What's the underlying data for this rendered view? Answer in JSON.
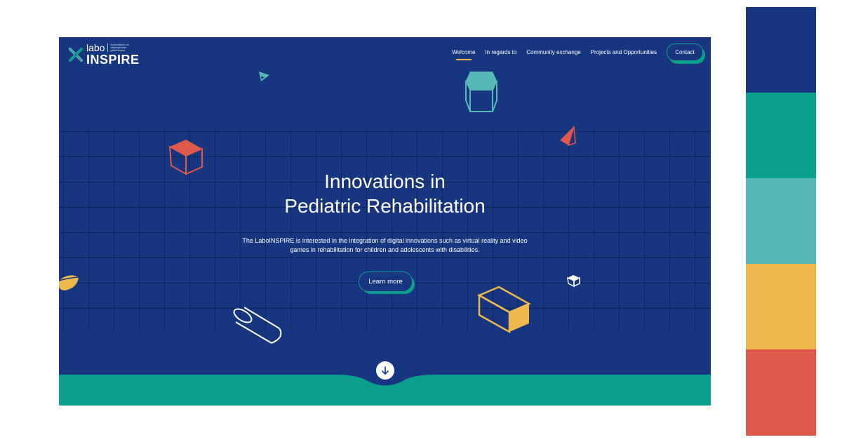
{
  "brand": {
    "labo": "labo",
    "tagline": "Innovations en réadaptation pédiatrique",
    "name": "INSPIRE"
  },
  "nav": {
    "items": [
      {
        "label": "Welcome",
        "active": true
      },
      {
        "label": "In regards to",
        "active": false
      },
      {
        "label": "Community exchange",
        "active": false
      },
      {
        "label": "Projects and Opportunities",
        "active": false
      }
    ],
    "contact_label": "Contact"
  },
  "hero": {
    "title_line1": "Innovations in",
    "title_line2": "Pediatric Rehabilitation",
    "description": "The LaboINSPIRE is interested in the integration of digital innovations such as virtual reality and video games in rehabilitation for children and adolescents with disabilities.",
    "cta_label": "Learn more"
  },
  "icons": {
    "logo": "labo-x-mark-icon",
    "scroll": "arrow-down-icon"
  },
  "colors": {
    "navy": "#18367f",
    "teal": "#0ba08b",
    "light_teal": "#55bab6",
    "yellow": "#ecb94f",
    "red": "#de584b",
    "white": "#ffffff"
  },
  "palette": [
    "#18367f",
    "#0ba08b",
    "#55bab6",
    "#ecb94f",
    "#de584b"
  ]
}
